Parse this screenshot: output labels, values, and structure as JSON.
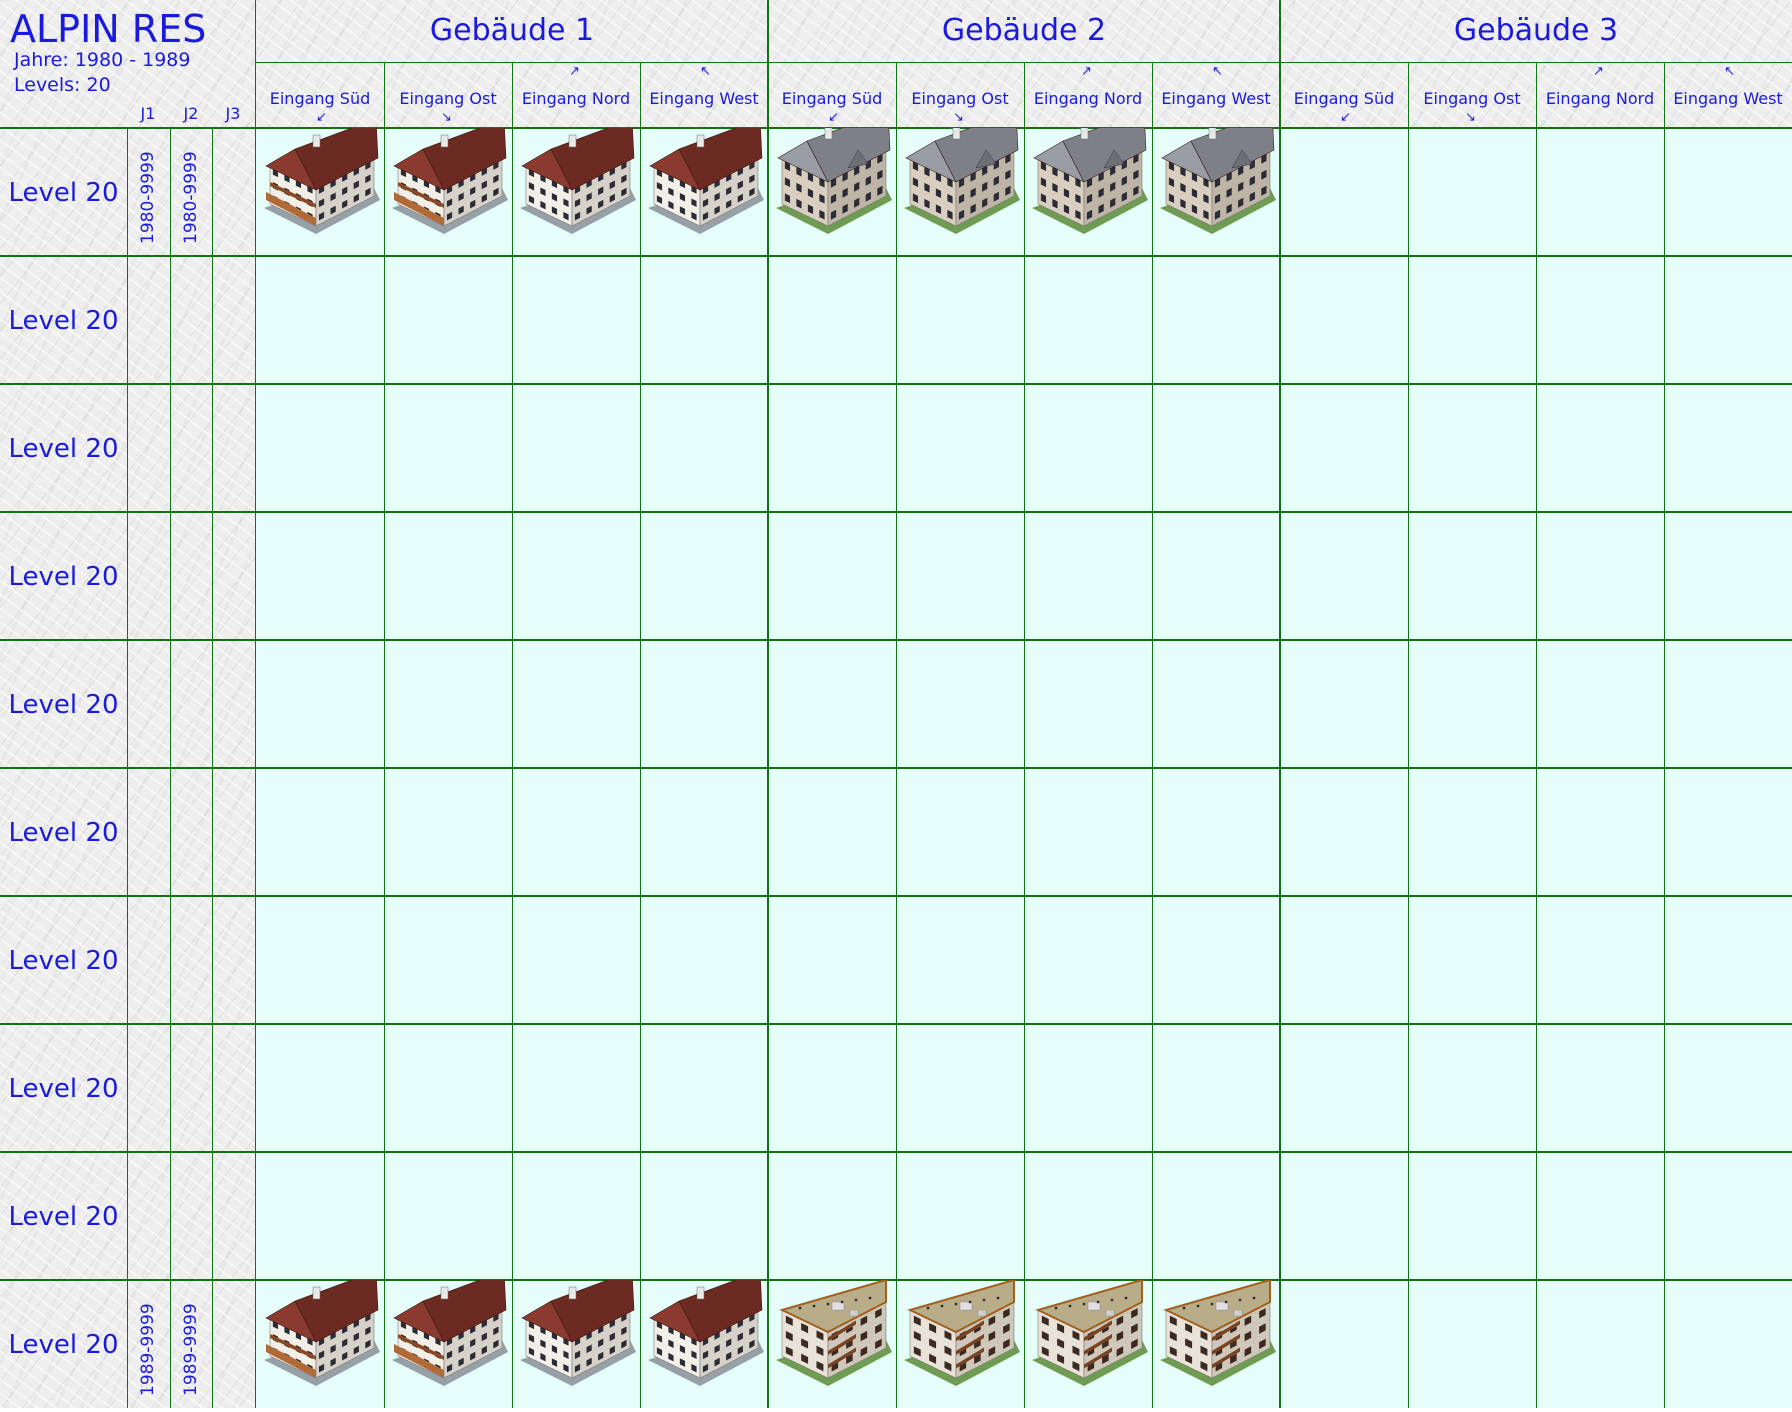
{
  "header": {
    "title": "ALPIN RES",
    "years": "Jahre: 1980 - 1989",
    "levels": "Levels: 20",
    "year_columns": [
      "J1",
      "J2",
      "J3"
    ]
  },
  "buildings": [
    "Gebäude 1",
    "Gebäude 2",
    "Gebäude 3"
  ],
  "entrances": [
    "Eingang Süd",
    "Eingang Ost",
    "Eingang Nord",
    "Eingang West"
  ],
  "rows": [
    {
      "label": "Level 20",
      "j1": "1980-9999",
      "j2": "1980-9999",
      "j3": "",
      "style": "chalet"
    },
    {
      "label": "Level 20",
      "j1": "",
      "j2": "",
      "j3": "",
      "style": ""
    },
    {
      "label": "Level 20",
      "j1": "",
      "j2": "",
      "j3": "",
      "style": ""
    },
    {
      "label": "Level 20",
      "j1": "",
      "j2": "",
      "j3": "",
      "style": ""
    },
    {
      "label": "Level 20",
      "j1": "",
      "j2": "",
      "j3": "",
      "style": ""
    },
    {
      "label": "Level 20",
      "j1": "",
      "j2": "",
      "j3": "",
      "style": ""
    },
    {
      "label": "Level 20",
      "j1": "",
      "j2": "",
      "j3": "",
      "style": ""
    },
    {
      "label": "Level 20",
      "j1": "",
      "j2": "",
      "j3": "",
      "style": ""
    },
    {
      "label": "Level 20",
      "j1": "",
      "j2": "",
      "j3": "",
      "style": ""
    },
    {
      "label": "Level 20",
      "j1": "1989-9999",
      "j2": "1989-9999",
      "j3": "",
      "style": "modern"
    }
  ],
  "colors": {
    "text": "#1a1adc",
    "grid": "#137313",
    "cell_bg": "#e6fefa",
    "roof_brown": "#6b2a22",
    "roof_grey": "#7d8088",
    "roof_flat": "#b8ad88"
  }
}
